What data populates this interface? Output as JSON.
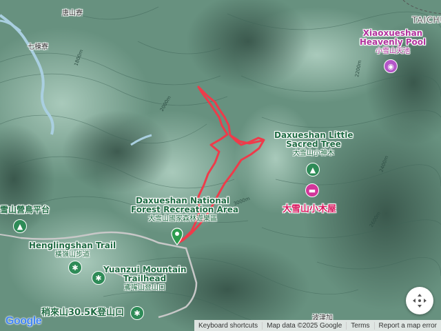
{
  "map": {
    "terrain_color": "#5f8a7a",
    "track_color": "#ee3b4a",
    "contour_labels": [
      "1800m",
      "2000m",
      "2200m",
      "2400m",
      "2600m",
      "3000m"
    ]
  },
  "places": {
    "tianlong": "唐山寮",
    "qike": "七棟寮",
    "taichung": "TAICHU",
    "jinjia": "波津加"
  },
  "pois": {
    "pool_en_1": "Xiaoxueshan",
    "pool_en_2": "Heavenly Pool",
    "pool_zh": "小雪山天池",
    "tree_en_1": "Daxueshan Little",
    "tree_en_2": "Sacred Tree",
    "tree_zh": "大雪山小神木",
    "cabin_zh": "大雪山小木屋",
    "forest_en_1": "Daxueshan National",
    "forest_en_2": "Forest Recreation Area",
    "forest_zh": "大雪山國家森林遊樂區",
    "camp_zh": "雪山營鳥平台",
    "trail_en": "Henglingshan Trail",
    "trail_zh": "橫嶺山步道",
    "yuanzui_en_1": "Yuanzui Mountain",
    "yuanzui_en_2": "Trailhead",
    "yuanzui_zh": "鳶嘴山登山口",
    "shaolai_zh": "稍來山30.5K登山口"
  },
  "icons": {
    "park": "tree-icon",
    "hiking": "hiker-icon",
    "camera": "camera-icon",
    "lodging": "bed-icon",
    "start": "start-pin-icon",
    "recenter": "crosshair-icon"
  },
  "attribution": {
    "shortcuts": "Keyboard shortcuts",
    "map_data": "Map data ©2025 Google",
    "terms": "Terms",
    "report": "Report a map error"
  },
  "logo": {
    "text": "Google"
  }
}
